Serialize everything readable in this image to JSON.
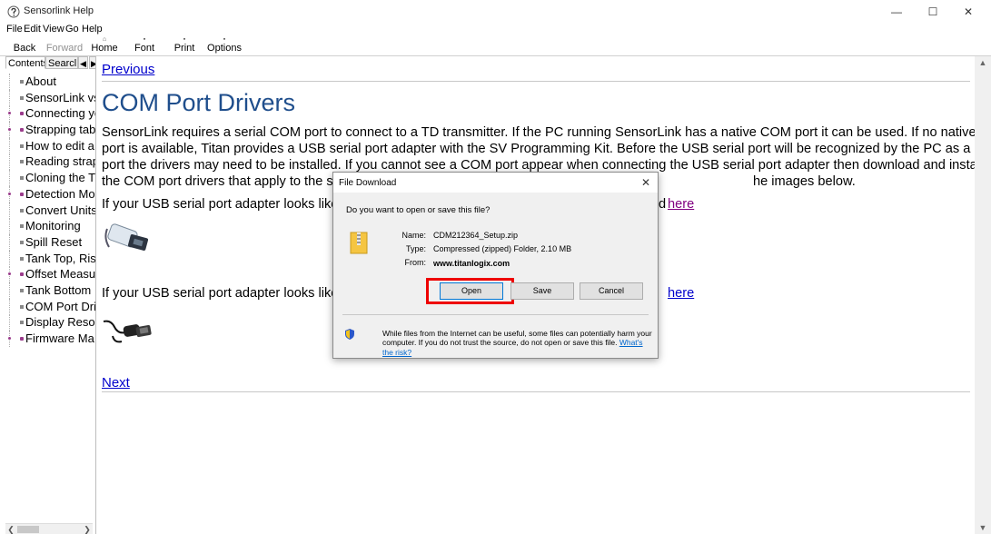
{
  "window": {
    "title": "Sensorlink Help",
    "minimize_glyph": "—",
    "maximize_glyph": "☐",
    "close_glyph": "✕"
  },
  "menu": [
    "File",
    "Edit",
    "View",
    "Go",
    "Help"
  ],
  "toolbar": {
    "back": "Back",
    "forward": "Forward",
    "home": "Home",
    "font": "Font",
    "print": "Print",
    "options": "Options"
  },
  "nav": {
    "tab_contents": "Contents",
    "tab_search": "Searcl",
    "tab_prev_glyph": "◀",
    "tab_next_glyph": "▶",
    "items": [
      {
        "label": "About",
        "type": "page"
      },
      {
        "label": "SensorLink vs",
        "type": "page"
      },
      {
        "label": "Connecting yo",
        "type": "book"
      },
      {
        "label": "Strapping tab",
        "type": "book"
      },
      {
        "label": "How to edit a",
        "type": "page"
      },
      {
        "label": "Reading strap",
        "type": "page"
      },
      {
        "label": "Cloning the Tl",
        "type": "page"
      },
      {
        "label": "Detection Mo",
        "type": "book"
      },
      {
        "label": "Convert Units",
        "type": "page"
      },
      {
        "label": "Monitoring",
        "type": "page"
      },
      {
        "label": "Spill Reset",
        "type": "page"
      },
      {
        "label": "Tank Top, Rise",
        "type": "page"
      },
      {
        "label": "Offset Measu",
        "type": "book"
      },
      {
        "label": "Tank Bottom",
        "type": "page"
      },
      {
        "label": "COM Port Dri",
        "type": "page"
      },
      {
        "label": "Display Resolu",
        "type": "page"
      },
      {
        "label": "Firmware Ma",
        "type": "book"
      }
    ]
  },
  "content": {
    "previous": "Previous",
    "heading": "COM Port Drivers",
    "para_lines": [
      "SensorLink requires a serial COM port to connect to a TD transmitter. If the PC running SensorLink has a native COM port it can be used. If no native COM",
      "port is available, Titan provides a USB serial port adapter with the SV Programming Kit. Before the USB serial port will be recognized by the PC as a COM",
      "port the drivers may need to be installed. If you cannot see a COM port appear when connecting the USB serial port adapter then download and install",
      "the COM port drivers that apply to the st",
      "he images below."
    ],
    "adapter_line_1": "If your USB serial port adapter looks like t",
    "adapter_line_1_end": "d",
    "here_1": "here",
    "adapter_line_2": "If your USB serial port adapter looks like t",
    "here_2": "here",
    "next": "Next"
  },
  "dialog": {
    "title": "File Download",
    "close_glyph": "✕",
    "question": "Do you want to open or save this file?",
    "name_label": "Name:",
    "name_value": "CDM212364_Setup.zip",
    "type_label": "Type:",
    "type_value": "Compressed (zipped) Folder, 2.10 MB",
    "from_label": "From:",
    "from_value": "www.titanlogix.com",
    "open_button": "Open",
    "save_button": "Save",
    "cancel_button": "Cancel",
    "warning": "While files from the Internet can be useful, some files can potentially harm your computer. If you do not trust the source, do not open or save this file.",
    "risk_link": "What's the risk?"
  },
  "colors": {
    "heading": "#1f4e8c",
    "link": "#0000cc",
    "visited_link": "#800080",
    "highlight": "#ee0000"
  }
}
